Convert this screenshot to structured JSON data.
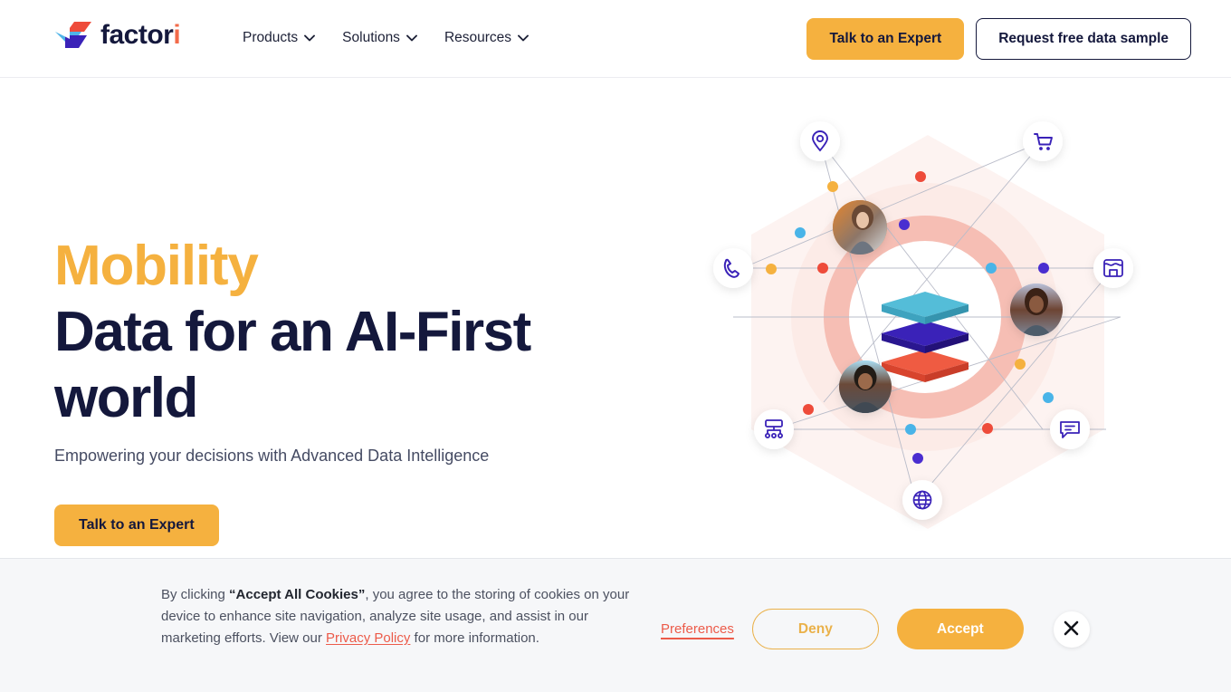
{
  "brand": {
    "name": "factori",
    "logo_icon": "factori-arrow-logo",
    "colors": {
      "accent_yellow": "#f5b13f",
      "navy": "#14183c",
      "logo_blue": "#4fb3e8",
      "logo_red": "#ee4b3a",
      "logo_purple": "#3a22b8",
      "link_red": "#ec5b4a"
    }
  },
  "header": {
    "nav": [
      {
        "label": "Products",
        "icon": "chevron-down-icon"
      },
      {
        "label": "Solutions",
        "icon": "chevron-down-icon"
      },
      {
        "label": "Resources",
        "icon": "chevron-down-icon"
      }
    ],
    "cta_primary": "Talk to an Expert",
    "cta_secondary": "Request free data sample"
  },
  "hero": {
    "kicker": "Mobility",
    "headline": "Data for an AI-First world",
    "subhead": "Empowering your decisions with Advanced Data Intelligence",
    "cta": "Talk to an Expert",
    "illustration": {
      "name": "data-network-illustration",
      "center_icon": "layered-stack-icon",
      "nodes": [
        "location-pin-icon",
        "shopping-cart-icon",
        "storefront-icon",
        "chat-bubble-icon",
        "globe-icon",
        "sitemap-icon",
        "phone-icon"
      ],
      "avatars": [
        "avatar-woman-top",
        "avatar-woman-right",
        "avatar-man-bottom"
      ]
    }
  },
  "cookie_banner": {
    "text_prefix": "By clicking ",
    "text_bold": "“Accept All Cookies”",
    "text_mid": ", you agree to the storing of cookies on your device to enhance site navigation, analyze site usage, and assist in our marketing efforts. View our ",
    "link": "Privacy Policy",
    "text_suffix": " for more information.",
    "preferences": "Preferences",
    "deny": "Deny",
    "accept": "Accept",
    "close_icon": "close-icon"
  }
}
